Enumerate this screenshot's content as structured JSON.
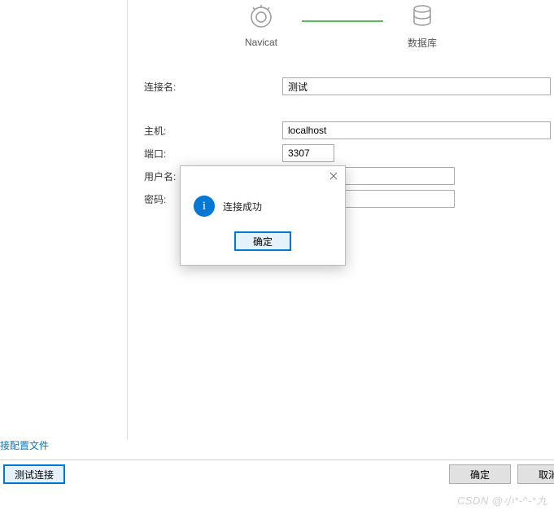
{
  "header": {
    "navicat_label": "Navicat",
    "database_label": "数据库"
  },
  "form": {
    "connection_name": {
      "label": "连接名:",
      "value": "测试"
    },
    "host": {
      "label": "主机:",
      "value": "localhost"
    },
    "port": {
      "label": "端口:",
      "value": "3307"
    },
    "username": {
      "label": "用户名:",
      "value": ""
    },
    "password": {
      "label": "密码:",
      "value": ""
    }
  },
  "link": {
    "config_file": "接配置文件"
  },
  "footer": {
    "test_connection": "测试连接",
    "ok": "确定",
    "cancel": "取消"
  },
  "modal": {
    "message": "连接成功",
    "ok": "确定"
  },
  "watermark": "CSDN @小*-^-*九"
}
